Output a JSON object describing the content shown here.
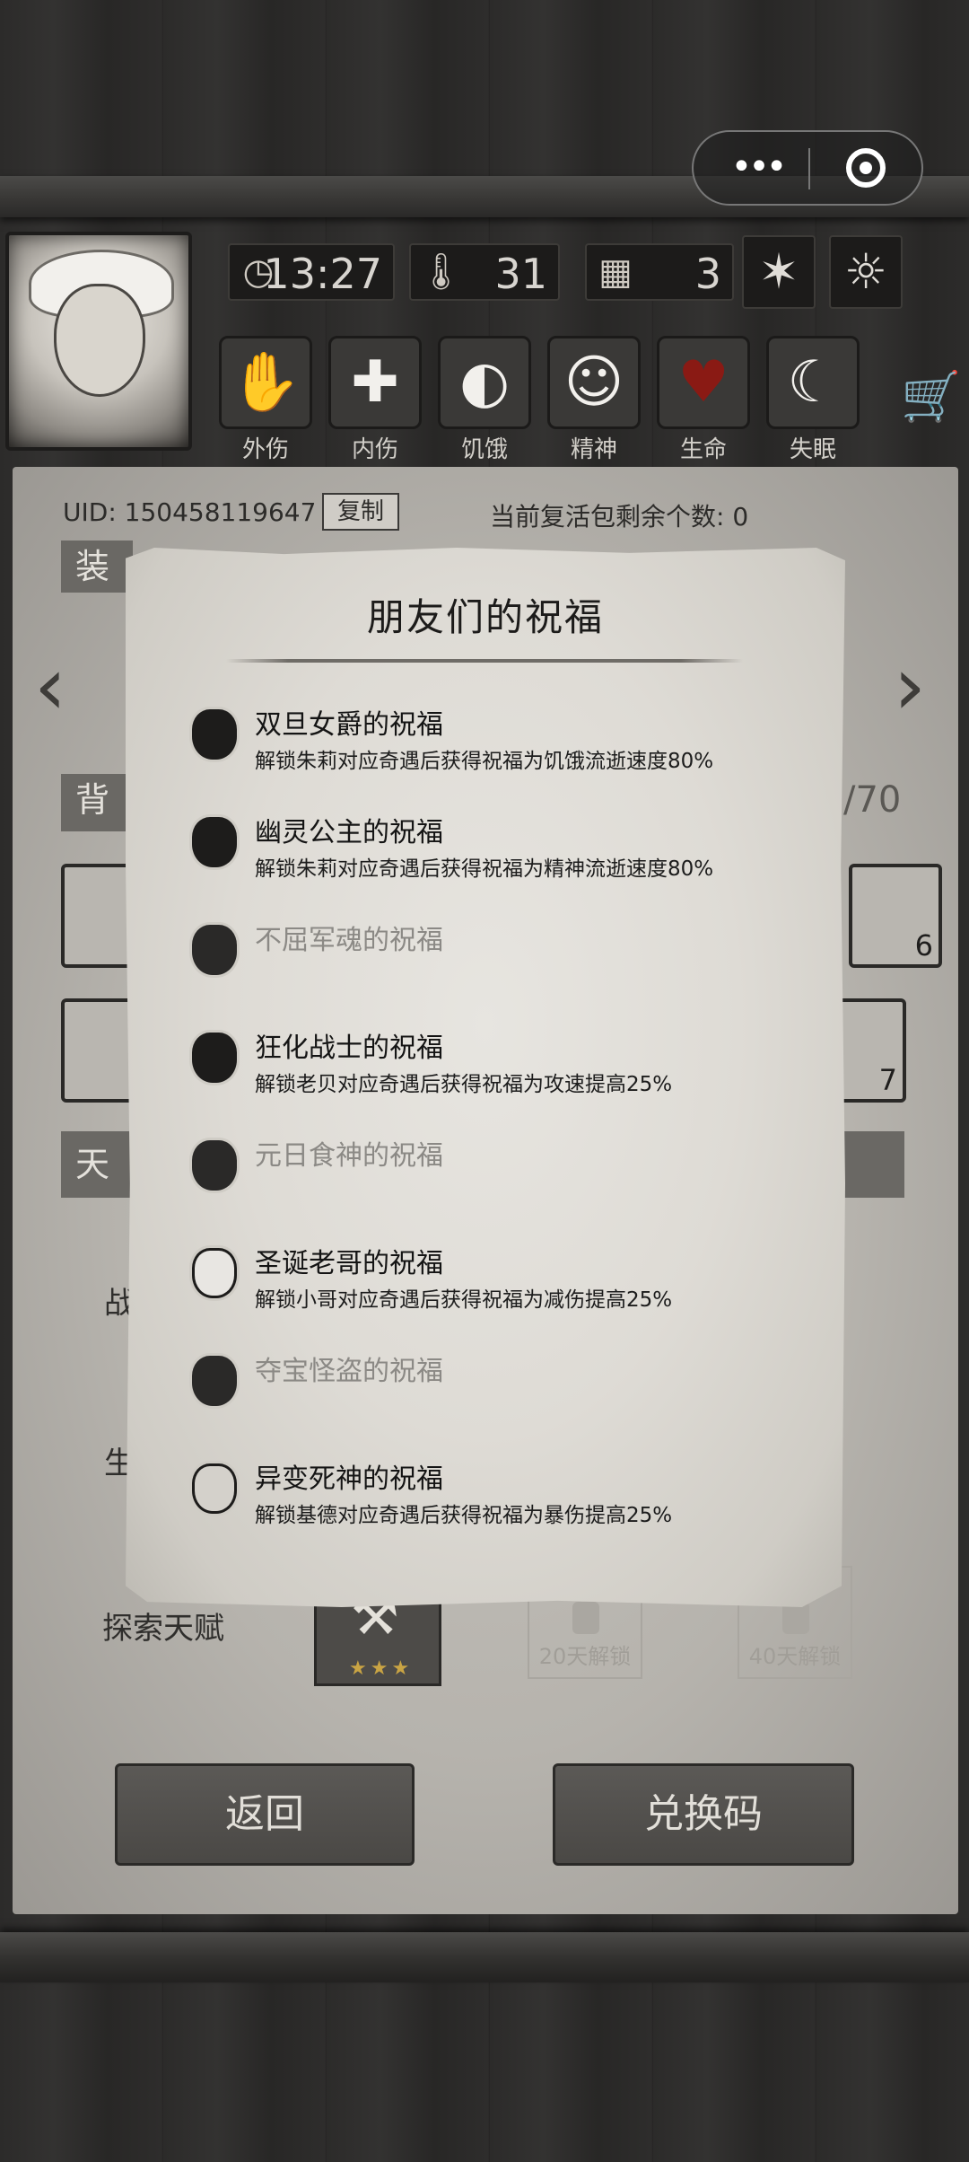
{
  "hud": {
    "time": "13:27",
    "temperature": "31",
    "day": "3",
    "stats": [
      {
        "label": "外伤",
        "icon": "hand-icon"
      },
      {
        "label": "内伤",
        "icon": "cross-icon"
      },
      {
        "label": "饥饿",
        "icon": "stomach-icon"
      },
      {
        "label": "精神",
        "icon": "head-icon"
      },
      {
        "label": "生命",
        "icon": "heart-icon"
      },
      {
        "label": "失眠",
        "icon": "moon-icon"
      }
    ]
  },
  "account": {
    "uid_label": "UID: 150458119647",
    "copy_label": "复制",
    "revive_label": "当前复活包剩余个数: 0"
  },
  "background_panel": {
    "equip_head": "装",
    "bag_head": "背",
    "bag_count": "/70",
    "talent_head": "天",
    "slot_count_a": "6",
    "slot_count_b": "7",
    "label_combat": "战",
    "label_survival": "生",
    "explore_label": "探索天赋",
    "lock_a": "20天解锁",
    "lock_b": "40天解锁",
    "stars": "★★★",
    "back_button": "返回",
    "redeem_button": "兑换码"
  },
  "dialog": {
    "title": "朋友们的祝福",
    "blessings": [
      {
        "name": "双旦女爵的祝福",
        "desc": "解锁朱莉对应奇遇后获得祝福为饥饿流逝速度80%",
        "unlocked": true
      },
      {
        "name": "幽灵公主的祝福",
        "desc": "解锁朱莉对应奇遇后获得祝福为精神流逝速度80%",
        "unlocked": true
      },
      {
        "name": "不屈军魂的祝福",
        "desc": "",
        "unlocked": false
      },
      {
        "name": "狂化战士的祝福",
        "desc": "解锁老贝对应奇遇后获得祝福为攻速提高25%",
        "unlocked": true
      },
      {
        "name": "元日食神的祝福",
        "desc": "",
        "unlocked": false
      },
      {
        "name": "圣诞老哥的祝福",
        "desc": "解锁小哥对应奇遇后获得祝福为减伤提高25%",
        "unlocked": true
      },
      {
        "name": "夺宝怪盗的祝福",
        "desc": "",
        "unlocked": false
      },
      {
        "name": "异变死神的祝福",
        "desc": "解锁基德对应奇遇后获得祝福为暴伤提高25%",
        "unlocked": true
      }
    ]
  },
  "colors": {
    "parchment": "#dedbd5",
    "heart": "#8a1a14",
    "text_dark": "#141414",
    "text_locked": "#8b8985"
  }
}
